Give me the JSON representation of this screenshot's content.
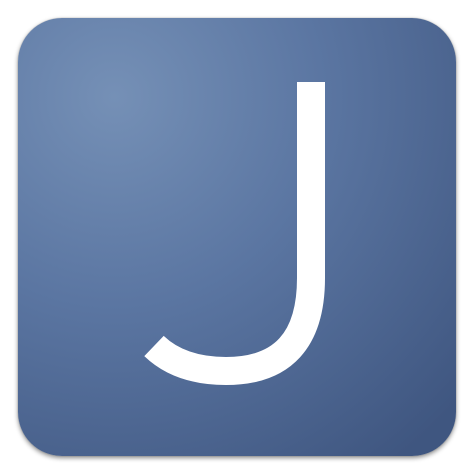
{
  "icon": {
    "letter": "J",
    "colors": {
      "highlight": "#7590b6",
      "mid": "#5b76a2",
      "shadow": "#3f5680",
      "glyph": "#ffffff"
    }
  }
}
